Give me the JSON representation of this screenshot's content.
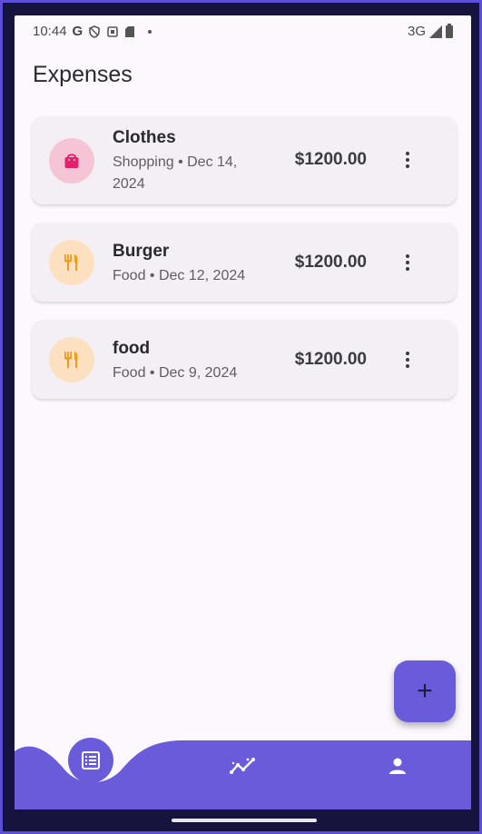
{
  "status_bar": {
    "time": "10:44",
    "google_letter": "G",
    "network": "3G"
  },
  "page": {
    "title": "Expenses"
  },
  "expenses": [
    {
      "name": "Clothes",
      "subtitle": "Shopping • Dec 14, 2024",
      "amount": "$1200.00",
      "category_icon": "shopping-bag-icon",
      "icon_color": "#e3226e",
      "icon_bg": "#f5c5d6"
    },
    {
      "name": "Burger",
      "subtitle": "Food • Dec 12, 2024",
      "amount": "$1200.00",
      "category_icon": "restaurant-icon",
      "icon_color": "#f29a1f",
      "icon_bg": "#fce0bf"
    },
    {
      "name": "food",
      "subtitle": "Food • Dec 9, 2024",
      "amount": "$1200.00",
      "category_icon": "restaurant-icon",
      "icon_color": "#f29a1f",
      "icon_bg": "#fce0bf"
    }
  ],
  "fab": {
    "label": "+",
    "icon": "add-icon"
  },
  "bottom_nav": {
    "items": [
      {
        "icon": "list-icon",
        "active": true
      },
      {
        "icon": "stats-icon",
        "active": false
      },
      {
        "icon": "profile-icon",
        "active": false
      }
    ]
  },
  "colors": {
    "primary": "#6a5bdb",
    "background": "#fcf8fd",
    "card": "#f3eff4",
    "text": "#2a2a2e"
  }
}
